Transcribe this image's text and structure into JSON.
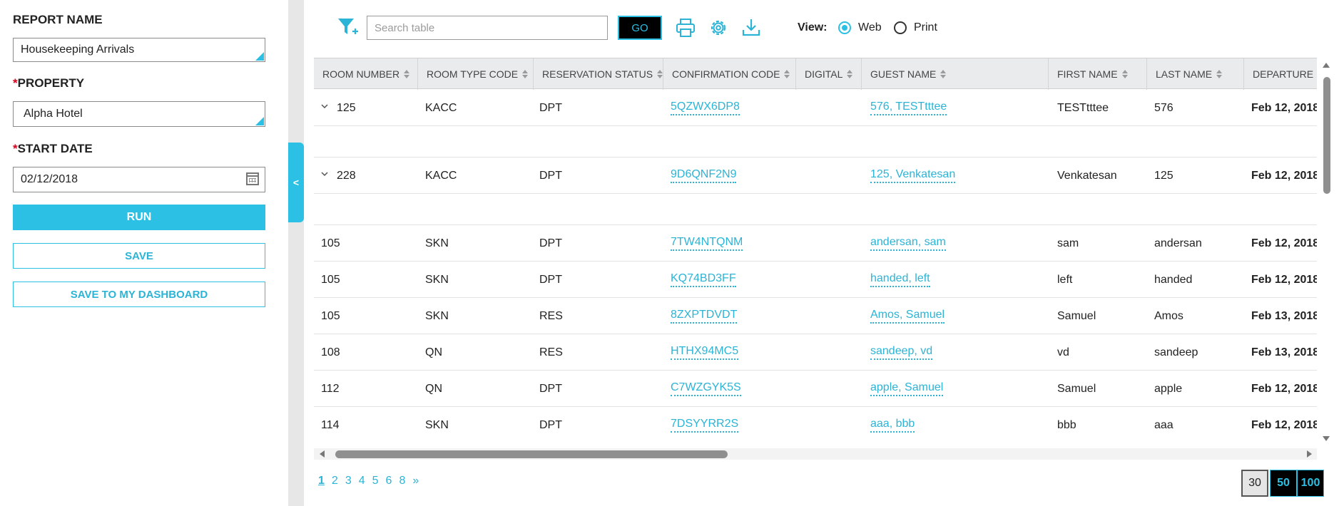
{
  "left_panel": {
    "report_name_label": "REPORT NAME",
    "report_name_value": "Housekeeping Arrivals",
    "property_label": "PROPERTY",
    "property_value": "Alpha Hotel",
    "start_date_label": "START DATE",
    "start_date_value": "02/12/2018",
    "required_marker": "*",
    "run_label": "RUN",
    "save_label": "SAVE",
    "save_dashboard_label": "SAVE TO MY DASHBOARD",
    "collapse_glyph": "<"
  },
  "toolbar": {
    "search_placeholder": "Search table",
    "go_label": "GO",
    "view_label": "View:",
    "view_options": [
      "Web",
      "Print"
    ],
    "view_selected": "Web",
    "icons": [
      "filter-icon",
      "print-icon",
      "gear-icon",
      "download-icon"
    ]
  },
  "table": {
    "columns": [
      "ROOM NUMBER",
      "ROOM TYPE CODE",
      "RESERVATION STATUS",
      "CONFIRMATION CODE",
      "DIGITAL",
      "GUEST NAME",
      "FIRST NAME",
      "LAST NAME",
      "DEPARTURE DATE"
    ],
    "rows": [
      {
        "room": "125",
        "type": "KACC",
        "status": "DPT",
        "conf": "5QZWX6DP8",
        "digital": "",
        "guest": "576, TESTtttee",
        "first": "TESTtttee",
        "last": "576",
        "departure": "Feb 12, 2018",
        "expandable": true
      },
      {
        "room": "228",
        "type": "KACC",
        "status": "DPT",
        "conf": "9D6QNF2N9",
        "digital": "",
        "guest": "125, Venkatesan",
        "first": "Venkatesan",
        "last": "125",
        "departure": "Feb 12, 2018",
        "expandable": true
      },
      {
        "room": "105",
        "type": "SKN",
        "status": "DPT",
        "conf": "7TW4NTQNM",
        "digital": "",
        "guest": "andersan, sam",
        "first": "sam",
        "last": "andersan",
        "departure": "Feb 12, 2018",
        "expandable": false
      },
      {
        "room": "105",
        "type": "SKN",
        "status": "DPT",
        "conf": "KQ74BD3FF",
        "digital": "",
        "guest": "handed, left",
        "first": "left",
        "last": "handed",
        "departure": "Feb 12, 2018",
        "expandable": false
      },
      {
        "room": "105",
        "type": "SKN",
        "status": "RES",
        "conf": "8ZXPTDVDT",
        "digital": "",
        "guest": "Amos, Samuel",
        "first": "Samuel",
        "last": "Amos",
        "departure": "Feb 13, 2018",
        "expandable": false
      },
      {
        "room": "108",
        "type": "QN",
        "status": "RES",
        "conf": "HTHX94MC5",
        "digital": "",
        "guest": "sandeep, vd",
        "first": "vd",
        "last": "sandeep",
        "departure": "Feb 13, 2018",
        "expandable": false
      },
      {
        "room": "112",
        "type": "QN",
        "status": "DPT",
        "conf": "C7WZGYK5S",
        "digital": "",
        "guest": "apple, Samuel",
        "first": "Samuel",
        "last": "apple",
        "departure": "Feb 12, 2018",
        "expandable": false
      },
      {
        "room": "114",
        "type": "SKN",
        "status": "DPT",
        "conf": "7DSYYRR2S",
        "digital": "",
        "guest": "aaa, bbb",
        "first": "bbb",
        "last": "aaa",
        "departure": "Feb 12, 2018",
        "expandable": false
      }
    ]
  },
  "pagination": {
    "pages": [
      "1",
      "2",
      "3",
      "4",
      "5",
      "6",
      "8",
      "»"
    ],
    "current": "1",
    "page_sizes": [
      "30",
      "50",
      "100"
    ],
    "selected_size": "30"
  },
  "colors": {
    "accent": "#2bc0e4",
    "link": "#2bb4d6",
    "required": "#d9001b"
  }
}
